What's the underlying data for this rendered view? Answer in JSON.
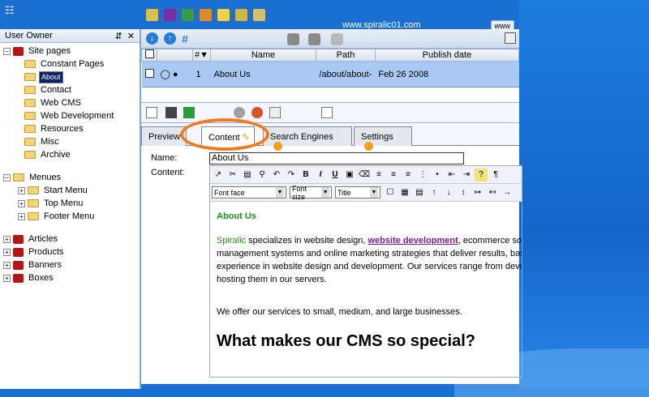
{
  "left": {
    "header_title": "User Owner",
    "tree": [
      {
        "label": "Site pages",
        "type": "book",
        "level": 0,
        "expander": "-"
      },
      {
        "label": "Constant Pages",
        "type": "folder",
        "level": 1
      },
      {
        "label": "About",
        "type": "folder-open",
        "level": 1,
        "selected": true
      },
      {
        "label": "Contact",
        "type": "folder",
        "level": 1
      },
      {
        "label": "Web CMS",
        "type": "folder",
        "level": 1
      },
      {
        "label": "Web Development",
        "type": "folder",
        "level": 1
      },
      {
        "label": "Resources",
        "type": "folder",
        "level": 1
      },
      {
        "label": "Misc",
        "type": "folder",
        "level": 1
      },
      {
        "label": "Archive",
        "type": "folder",
        "level": 1
      }
    ],
    "menues": {
      "label": "Menues",
      "children": [
        "Start Menu",
        "Top Menu",
        "Footer Menu"
      ]
    },
    "others": [
      "Articles",
      "Products",
      "Banners",
      "Boxes"
    ]
  },
  "top": {
    "url": "www.spiralic01.com",
    "www_label": "www"
  },
  "grid": {
    "headers": [
      "#▼",
      "Name",
      "Path",
      "Publish date"
    ],
    "row": {
      "num": "1",
      "name": "About Us",
      "path": "/about/about-",
      "date": "Feb 26 2008"
    }
  },
  "tabs": [
    "Preview",
    "Content",
    "Search Engines",
    "Settings"
  ],
  "form": {
    "name_label": "Name:",
    "name_value": "About Us",
    "content_label": "Content:"
  },
  "editor": {
    "font_face": "Font face",
    "font_size": "Font size",
    "title_sel": "Title",
    "heading": "About Us",
    "p1_brand": "Spiralic",
    "p1_a": " specializes in website design, ",
    "p1_link": "website development",
    "p1_b": ", ecommerce solutions, cor",
    "p2": "management systems and online marketing strategies that deliver results, based on ext",
    "p3": "experience in website design and development. Our services range from developing web",
    "p4": "hosting them in our servers.",
    "p5": "We offer our services to small, medium, and large businesses.",
    "big": "What makes our CMS so special?"
  },
  "colors": {
    "accent": "#1a6fd0",
    "highlight": "#ee7b22",
    "row_selected": "#a9c9f2"
  }
}
